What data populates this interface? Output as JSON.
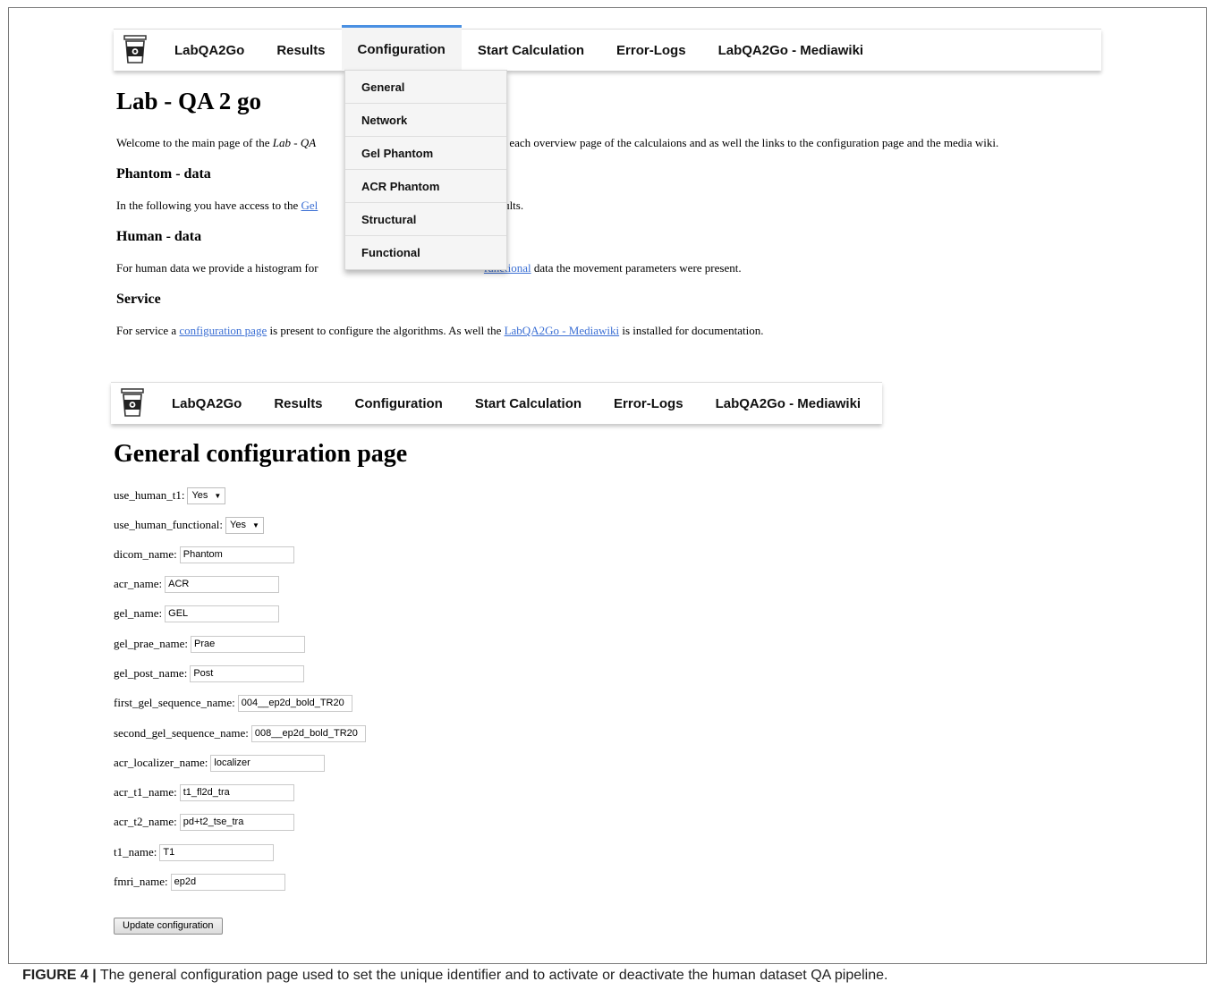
{
  "nav": {
    "logo": "cup-logo",
    "items": [
      "LabQA2Go",
      "Results",
      "Configuration",
      "Start Calculation",
      "Error-Logs",
      "LabQA2Go - Mediawiki"
    ],
    "active": "Configuration"
  },
  "dropdown": [
    "General",
    "Network",
    "Gel Phantom",
    "ACR Phantom",
    "Structural",
    "Functional"
  ],
  "main": {
    "title": "Lab - QA 2 go",
    "welcome_pre": "Welcome to the main page of the ",
    "welcome_italic": "Lab - QA",
    "welcome_post": "ks to each overview page of the calculaions and as well the links to the configuration page and the media wiki.",
    "phantom_heading": "Phantom - data",
    "phantom_pre": "In the following you have access to the ",
    "phantom_link": "Gel",
    "phantom_post": "ta results.",
    "human_heading": "Human - data",
    "human_pre": "For human data we provide a histogram for ",
    "human_link_functional": "functional",
    "human_post": " data the movement parameters were present.",
    "service_heading": "Service",
    "service_pre": "For service a ",
    "service_link_config": "configuration page",
    "service_mid": " is present to configure the algorithms. As well the ",
    "service_link_wiki": "LabQA2Go - Mediawiki",
    "service_post": " is installed for documentation."
  },
  "config": {
    "title": "General configuration page",
    "selects": [
      {
        "label": "use_human_t1:",
        "value": "Yes"
      },
      {
        "label": "use_human_functional:",
        "value": "Yes"
      }
    ],
    "fields": [
      {
        "label": "dicom_name:",
        "value": "Phantom"
      },
      {
        "label": "acr_name:",
        "value": "ACR"
      },
      {
        "label": "gel_name:",
        "value": "GEL"
      },
      {
        "label": "gel_prae_name:",
        "value": "Prae"
      },
      {
        "label": "gel_post_name:",
        "value": "Post"
      },
      {
        "label": "first_gel_sequence_name:",
        "value": "004__ep2d_bold_TR20"
      },
      {
        "label": "second_gel_sequence_name:",
        "value": "008__ep2d_bold_TR20"
      },
      {
        "label": "acr_localizer_name:",
        "value": "localizer"
      },
      {
        "label": "acr_t1_name:",
        "value": "t1_fl2d_tra"
      },
      {
        "label": "acr_t2_name:",
        "value": "pd+t2_tse_tra"
      },
      {
        "label": "t1_name:",
        "value": "T1"
      },
      {
        "label": "fmri_name:",
        "value": "ep2d"
      }
    ],
    "update_button": "Update configuration"
  },
  "caption": {
    "label": "FIGURE 4 |",
    "text": " The general configuration page used to set the unique identifier and to activate or deactivate the human dataset QA pipeline."
  }
}
